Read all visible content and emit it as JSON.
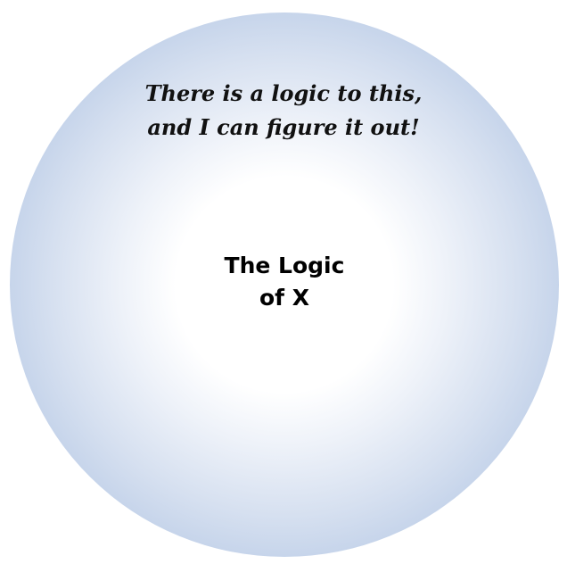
{
  "diagram": {
    "outer_label_lines": [
      "There is a logic to this,",
      "and I can figure it out!"
    ],
    "center_label_lines": [
      "The Logic",
      "of X"
    ],
    "colors": {
      "outer_edge": "#9db6dc",
      "center_fill": "#ffffff",
      "text": "#000000"
    }
  }
}
